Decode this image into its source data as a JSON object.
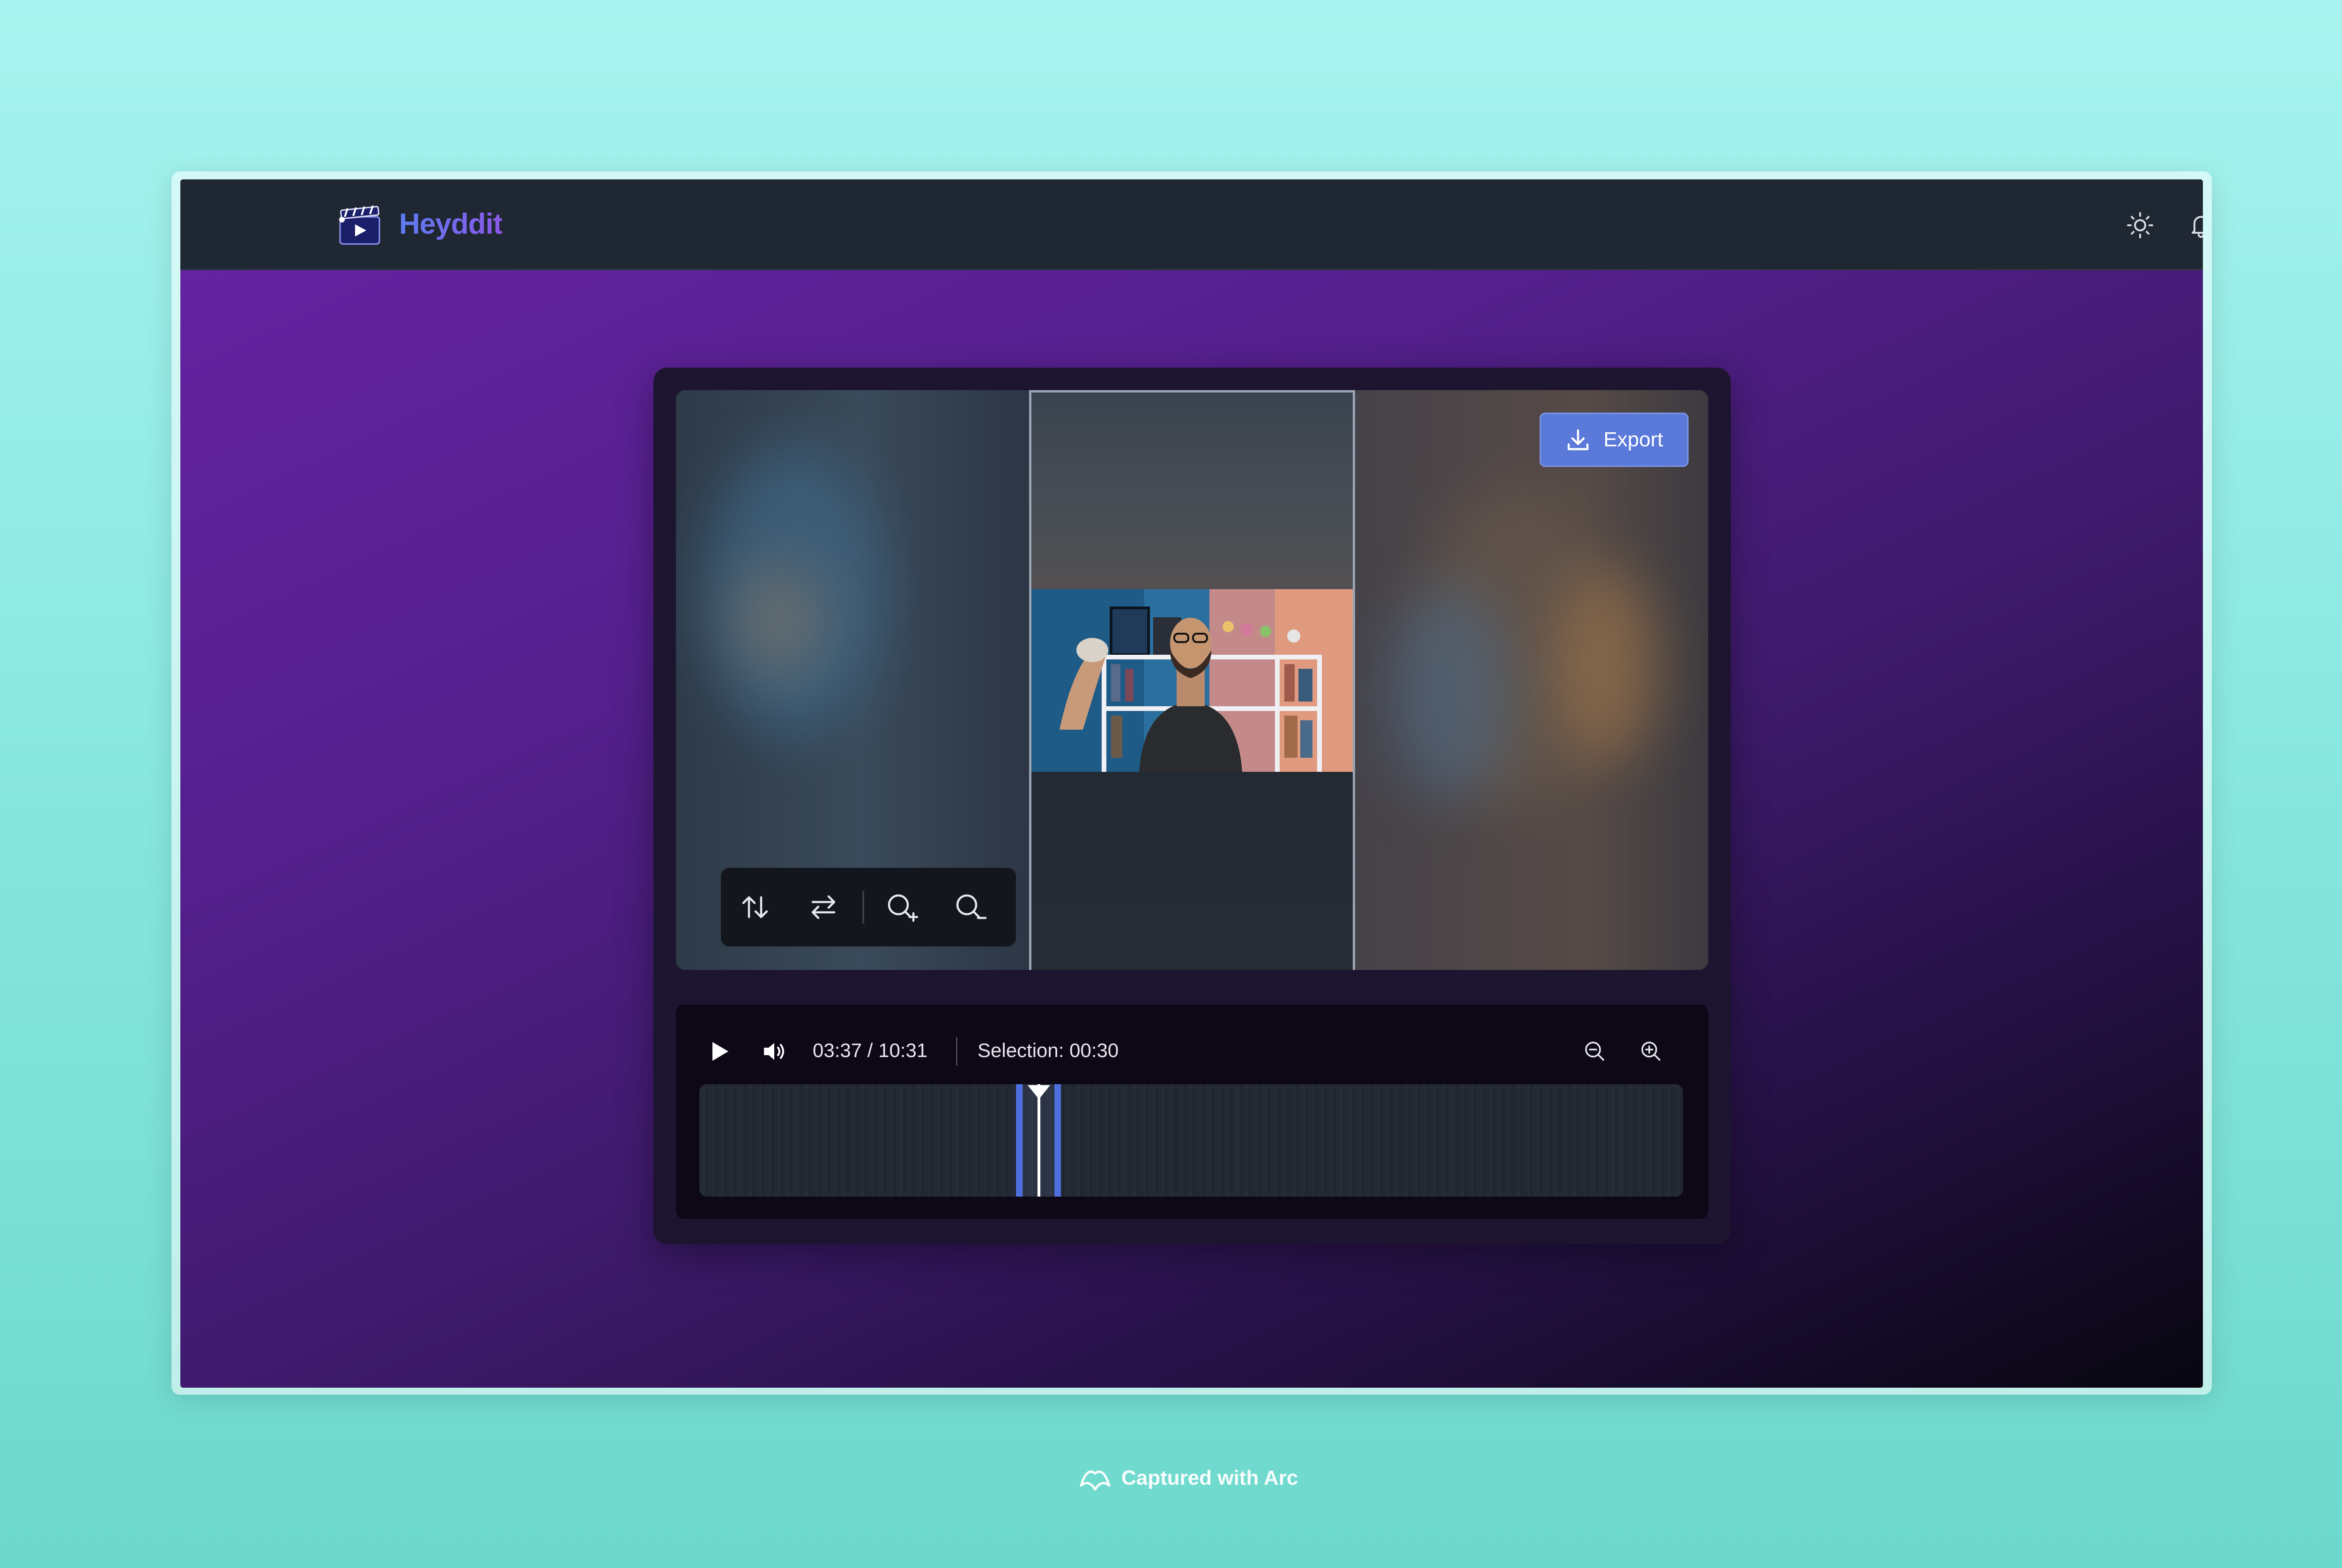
{
  "app": {
    "brand_name": "Heyddit"
  },
  "header": {
    "theme_toggle_icon": "sun-icon",
    "notifications_icon": "bell-icon",
    "notification_dot_color": "#a35cf0"
  },
  "editor": {
    "export_label": "Export",
    "export_icon": "download-icon",
    "toolbar": {
      "tools": [
        "swap-vertical-icon",
        "swap-horizontal-icon",
        "zoom-in-icon",
        "zoom-out-icon"
      ]
    }
  },
  "timeline": {
    "time_display": "03:37 / 10:31",
    "selection_display": "Selection: 00:30",
    "current_time_fraction": 0.344,
    "accent_color": "#4f6fe0"
  },
  "footer": {
    "captured_text": "Captured with Arc"
  }
}
